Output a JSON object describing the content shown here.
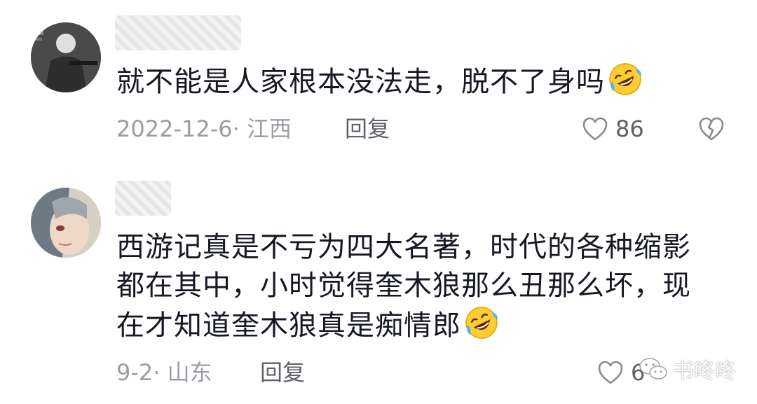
{
  "comments": [
    {
      "username": "",
      "text": "就不能是人家根本没法走，脱不了身吗",
      "emoji": "rolling-on-floor-laughing-emoji",
      "date_location": "2022-12-6· 江西",
      "reply_label": "回复",
      "like_count": "86"
    },
    {
      "username": "",
      "text": "西游记真是不亏为四大名著，时代的各种缩影都在其中，小时觉得奎木狼那么丑那么坏，现在才知道奎木狼真是痴情郎",
      "emoji": "rolling-on-floor-laughing-emoji",
      "date_location": "9-2· 山东",
      "reply_label": "回复",
      "like_count": "6"
    }
  ],
  "watermark": {
    "label": "书咚咚",
    "icon": "wechat-icon"
  },
  "colors": {
    "text": "#161823",
    "meta": "#9c9da4",
    "action": "#5f6068",
    "emoji_face": "#ffcc33"
  }
}
